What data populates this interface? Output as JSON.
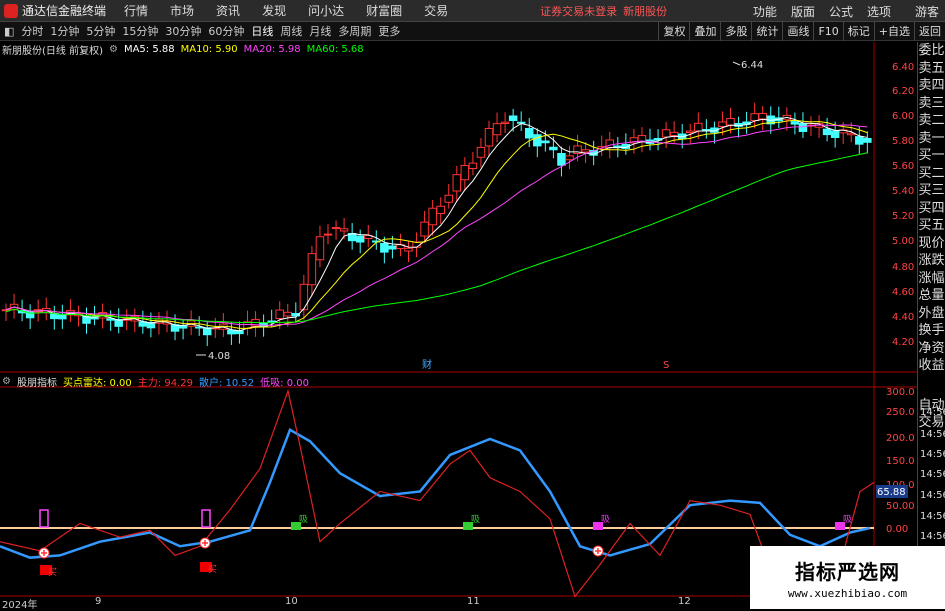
{
  "menubar": {
    "app_title": "通达信金融终端",
    "items": [
      "行情",
      "市场",
      "资讯",
      "发现",
      "问小达",
      "财富圈",
      "交易"
    ],
    "notice": "证券交易未登录",
    "stock": "新朋股份",
    "right_items": [
      "功能",
      "版面",
      "公式",
      "选项",
      "游客"
    ]
  },
  "toolbar": {
    "periods": [
      "分时",
      "1分钟",
      "5分钟",
      "15分钟",
      "30分钟",
      "60分钟",
      "日线",
      "周线",
      "月线",
      "多周期",
      "更多"
    ],
    "active": "日线",
    "right_buttons": [
      "复权",
      "叠加",
      "多股",
      "统计",
      "画线",
      "F10",
      "标记",
      "+自选",
      "返回"
    ]
  },
  "price_info": {
    "name": "新朋股份(日线 前复权)",
    "ma5": "MA5: 5.88",
    "ma10": "MA10: 5.90",
    "ma20": "MA20: 5.98",
    "ma60": "MA60: 5.68",
    "colors": {
      "ma5": "#ffffff",
      "ma10": "#ffff00",
      "ma20": "#ff44ff",
      "ma60": "#00ff00"
    }
  },
  "indicator_info": {
    "name": "股朋指标",
    "buy": "买点雷达: 0.00",
    "main": "主力: 94.29",
    "retail": "散户: 10.52",
    "low": "低吸: 0.00"
  },
  "right_panel": [
    "委比",
    "卖五",
    "卖四",
    "卖三",
    "卖二",
    "卖一",
    "买一",
    "买二",
    "买三",
    "买四",
    "买五",
    "现价",
    "涨跌",
    "涨幅",
    "总量",
    "外盘",
    "换手",
    "净资",
    "收益",
    "自动",
    "交易"
  ],
  "price_axis": [
    "6.40",
    "6.20",
    "6.00",
    "5.80",
    "5.60",
    "5.40",
    "5.20",
    "5.00",
    "4.80",
    "4.60",
    "4.40",
    "4.20"
  ],
  "ind_axis": [
    "300.0",
    "250.0",
    "200.0",
    "150.0",
    "100.0",
    "50.00",
    "0.00"
  ],
  "time_labels": [
    "14:56",
    "14:56",
    "14:56",
    "14:56",
    "14:56",
    "14:56",
    "14:56",
    "14:56"
  ],
  "current_ind_value": "65.88",
  "annotations": {
    "high": "6.44",
    "low": "4.08",
    "cai": "财",
    "s": "S"
  },
  "signals": {
    "buy_text": "买",
    "xi_text": "吸"
  },
  "dates": [
    "2024年",
    "9",
    "10",
    "11",
    "12"
  ],
  "watermark": {
    "main": "指标严选网",
    "url": "www.xuezhibiao.com"
  }
}
